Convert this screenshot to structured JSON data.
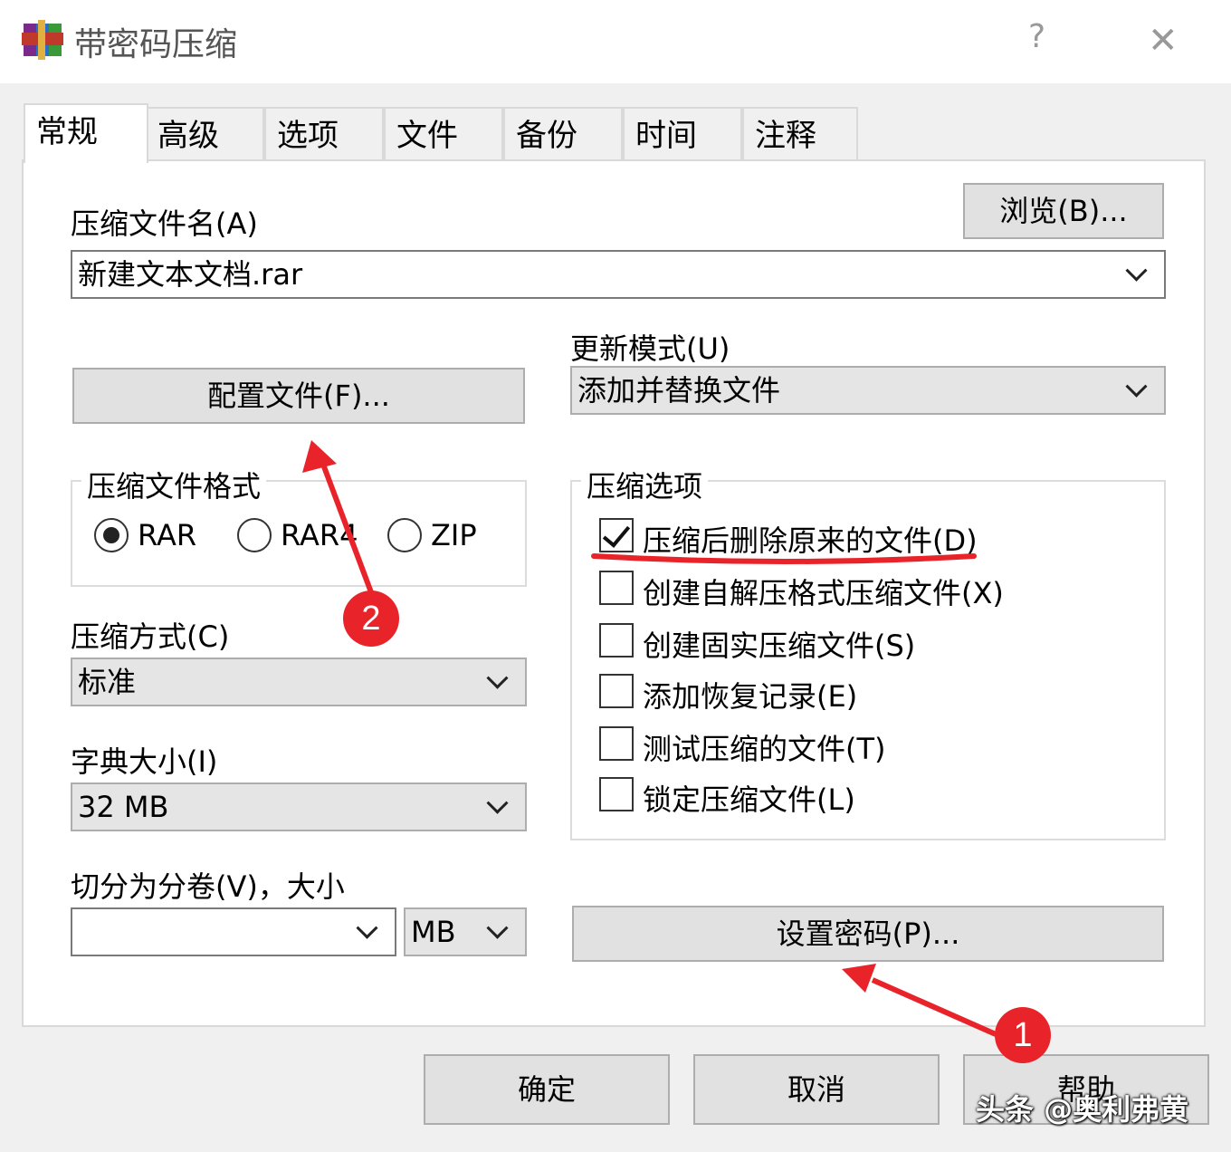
{
  "window": {
    "title": "带密码压缩",
    "help_glyph": "?",
    "close_glyph": "✕"
  },
  "tabs": [
    {
      "label": "常规"
    },
    {
      "label": "高级"
    },
    {
      "label": "选项"
    },
    {
      "label": "文件"
    },
    {
      "label": "备份"
    },
    {
      "label": "时间"
    },
    {
      "label": "注释"
    }
  ],
  "general": {
    "archive_name_label": "压缩文件名(A)",
    "archive_name_value": "新建文本文档.rar",
    "browse_label": "浏览(B)...",
    "update_mode_label": "更新模式(U)",
    "update_mode_value": "添加并替换文件",
    "profiles_label": "配置文件(F)...",
    "format_group_label": "压缩文件格式",
    "formats": [
      {
        "label": "RAR",
        "selected": true
      },
      {
        "label": "RAR4",
        "selected": false
      },
      {
        "label": "ZIP",
        "selected": false
      }
    ],
    "method_label": "压缩方式(C)",
    "method_value": "标准",
    "dict_label": "字典大小(I)",
    "dict_value": "32 MB",
    "split_label": "切分为分卷(V)，大小",
    "split_value": "",
    "split_unit": "MB",
    "options_group_label": "压缩选项",
    "options": [
      {
        "label": "压缩后删除原来的文件(D)",
        "checked": true
      },
      {
        "label": "创建自解压格式压缩文件(X)",
        "checked": false
      },
      {
        "label": "创建固实压缩文件(S)",
        "checked": false
      },
      {
        "label": "添加恢复记录(E)",
        "checked": false
      },
      {
        "label": "测试压缩的文件(T)",
        "checked": false
      },
      {
        "label": "锁定压缩文件(L)",
        "checked": false
      }
    ],
    "set_password_label": "设置密码(P)..."
  },
  "footer": {
    "ok_label": "确定",
    "cancel_label": "取消",
    "help_label": "帮助"
  },
  "annotations": {
    "badge1": "1",
    "badge2": "2",
    "accent_color": "#e8242a"
  },
  "watermark": "头条 @奥利弗黄"
}
